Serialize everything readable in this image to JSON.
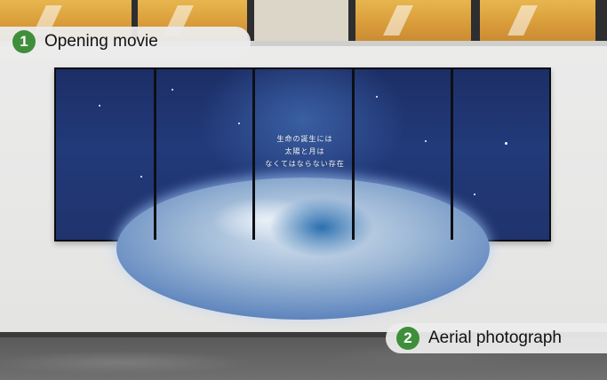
{
  "labels": [
    {
      "number": "1",
      "text": "Opening movie"
    },
    {
      "number": "2",
      "text": "Aerial photograph"
    }
  ],
  "screen_text": [
    "生命の誕生には",
    "太陽と月は",
    "なくてはならない存在"
  ],
  "colors": {
    "badge_green": "#3f8f3a",
    "label_background": "#ececec",
    "space_blue": "#1c2e66"
  }
}
